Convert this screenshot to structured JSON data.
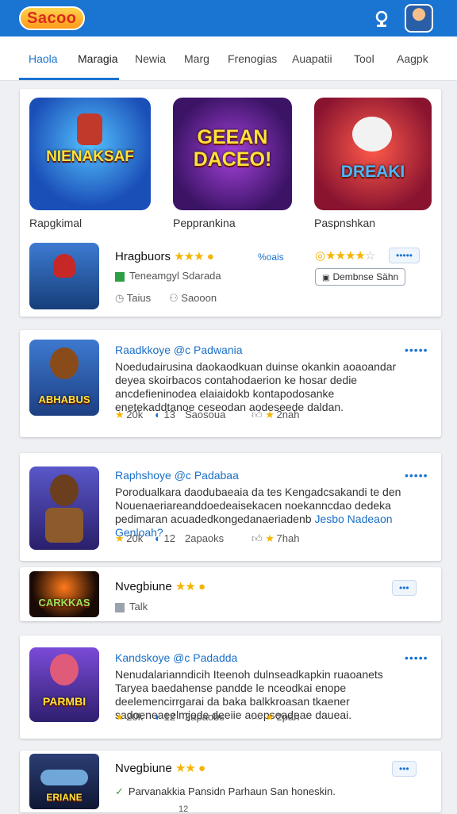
{
  "header": {
    "logo": "Sacoo",
    "bell_icon": "bell-icon",
    "avatar_icon": "user-avatar"
  },
  "tabs": [
    "Haola",
    "Maragia",
    "Newia",
    "Marg",
    "Frenogias",
    "Auapatii",
    "Tool",
    "Aagpk"
  ],
  "featured": {
    "items": [
      {
        "art": "NIENAKSAF",
        "caption": "Rapgkimal"
      },
      {
        "art": "GEEAN DACEO!",
        "caption": "Pepprankina"
      },
      {
        "art": "DREAKI",
        "caption": "Paspnshkan"
      }
    ],
    "row": {
      "title": "Hragbuors",
      "rating_label": "%oais",
      "sub": "Teneamgyl Sdarada",
      "meta_a": "Taius",
      "meta_b": "Saooon",
      "outline_button": "Dembnse Sähn",
      "dots": "•••••"
    }
  },
  "posts": [
    {
      "title": "Raadkkoye @c  Padwania",
      "text": "Noedudairusina daokaodkuan duinse okankin aoaoandar deyea skoirbacos contahodaerion ke hosar dedie ancdefieninodea elaiaidokb kontapodosanke enetekaddtanoe ceseodan aodeseede daldan.",
      "likes": "20k",
      "comments": "13",
      "shares": "Saosoua",
      "reactions": "2nah"
    },
    {
      "title": "Raphshoye @c  Padabaa",
      "text": "Porodualkara daodubaeaia da tes Kengadcsakandi te den Nouenaeriareanddoedeaisekacen noekanncdao dedeka pedimaran acuadedkongedanaeriadenb",
      "text_link": "Jesbo Nadeaon Genloah?",
      "likes": "20k",
      "comments": "12",
      "shares": "2apaoks",
      "reactions": "7hah"
    }
  ],
  "mini1": {
    "art": "CARKKAS",
    "title": "Nvegbiune",
    "meta": "Talk",
    "dots": "•••"
  },
  "post3": {
    "title": "Kandskoye @c  Padadda",
    "text": "Nenudalarianndicih Iteenoh dulnseadkapkin ruaoanets Taryea baedahense pandde le nceodkai enope deelemencirrgarai da baka balkkroasan tkaener sadoeneaeelmjode deeiie aoepseadeae daueai.",
    "likes": "20k",
    "comments": "12",
    "shares": "2apaobs",
    "reactions": "2pah"
  },
  "mini2": {
    "art": "ERIANE",
    "title": "Nvegbiune",
    "sub": "Parvanakkia Pansidn Parhaun San honeskin.",
    "meta": "12",
    "dots": "•••"
  },
  "colors": {
    "brand": "#1a74d2",
    "star": "#f4b400"
  }
}
